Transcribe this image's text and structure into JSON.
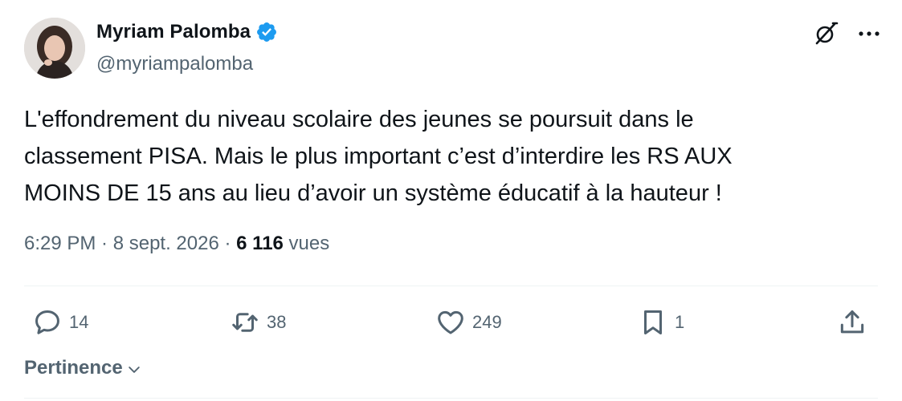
{
  "author": {
    "display_name": "Myriam Palomba",
    "handle": "@myriampalomba",
    "verified": true
  },
  "header_icons": {
    "grok": "grok-icon",
    "more": "more-icon"
  },
  "tweet": {
    "text": "L'effondrement du niveau scolaire des jeunes se poursuit dans le\nclassement PISA. Mais le plus important c’est d’interdire les RS AUX\nMOINS DE 15 ans au lieu d’avoir un système éducatif à la hauteur !",
    "time": "6:29 PM",
    "separator": " · ",
    "date": "8 sept. 2026",
    "views_count": "6 116",
    "views_label": " vues"
  },
  "actions": {
    "replies": "14",
    "retweets": "38",
    "likes": "249",
    "bookmarks": "1"
  },
  "sort": {
    "label": "Pertinence"
  },
  "colors": {
    "text": "#0f1419",
    "secondary": "#536471",
    "verified": "#1d9bf0",
    "divider": "#eff3f4"
  }
}
